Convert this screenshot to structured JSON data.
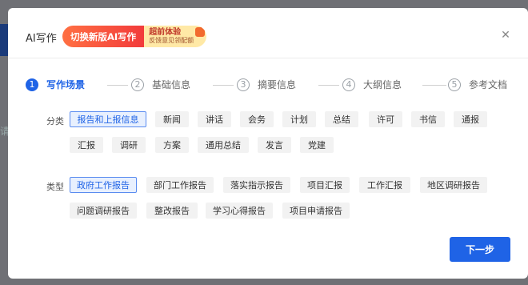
{
  "background": {
    "text": "请"
  },
  "modal": {
    "title": "AI写作",
    "promo": {
      "left": "切换新版AI写作",
      "top": "超前体验",
      "bottom": "反馈意见领配额"
    }
  },
  "steps": [
    {
      "num": "1",
      "label": "写作场景"
    },
    {
      "num": "2",
      "label": "基础信息"
    },
    {
      "num": "3",
      "label": "摘要信息"
    },
    {
      "num": "4",
      "label": "大纲信息"
    },
    {
      "num": "5",
      "label": "参考文档"
    }
  ],
  "category": {
    "label": "分类",
    "tags": [
      "报告和上报信息",
      "新闻",
      "讲话",
      "会务",
      "计划",
      "总结",
      "许可",
      "书信",
      "通报",
      "汇报",
      "调研",
      "方案",
      "通用总结",
      "发言",
      "党建"
    ]
  },
  "type": {
    "label": "类型",
    "tags": [
      "政府工作报告",
      "部门工作报告",
      "落实指示报告",
      "项目汇报",
      "工作汇报",
      "地区调研报告",
      "问题调研报告",
      "整改报告",
      "学习心得报告",
      "项目申请报告"
    ]
  },
  "actions": {
    "next": "下一步"
  },
  "colors": {
    "accent": "#1f63e6",
    "promo": "#f23b3b"
  }
}
